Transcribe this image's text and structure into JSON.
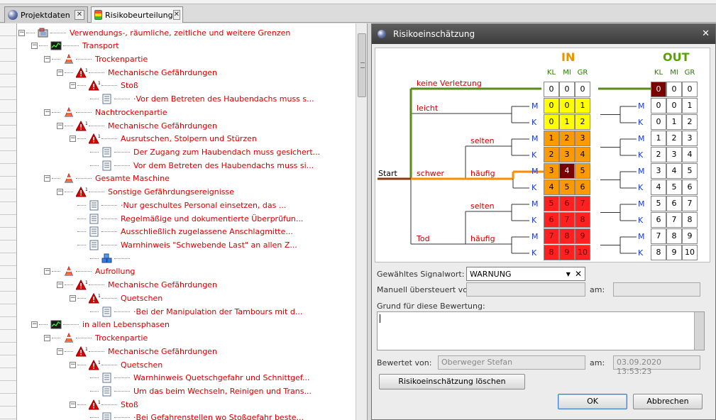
{
  "tabs": [
    {
      "label": "Projektdaten"
    },
    {
      "label": "Risikobeurteilung"
    }
  ],
  "tab_close_glyph": "✕",
  "tree": {
    "rows": [
      {
        "level": 0,
        "icon": "machine-icon",
        "label": "Verwendungs-, räumliche, zeitliche und weitere Grenzen",
        "expand": "−"
      },
      {
        "level": 1,
        "icon": "phase-icon",
        "label": "Transport",
        "expand": "−"
      },
      {
        "level": 2,
        "icon": "cone-icon",
        "label": "Trockenpartie",
        "expand": "−"
      },
      {
        "level": 3,
        "icon": "hazard-icon",
        "label": "Mechanische Gefährdungen",
        "expand": "−"
      },
      {
        "level": 4,
        "icon": "hazard-icon",
        "label": "Stoß",
        "expand": "−"
      },
      {
        "level": 5,
        "icon": "measure-icon",
        "label": "·Vor dem Betreten des Haubendachs muss s...",
        "expand": ""
      },
      {
        "level": 2,
        "icon": "cone-icon",
        "label": "Nachtrockenpartie",
        "expand": "−"
      },
      {
        "level": 3,
        "icon": "hazard-icon",
        "label": "Mechanische Gefährdungen",
        "expand": "−"
      },
      {
        "level": 4,
        "icon": "hazard-icon",
        "label": "Ausrutschen, Stolpern und Stürzen",
        "expand": "−"
      },
      {
        "level": 5,
        "icon": "measure-icon",
        "label": "Der Zugang zum Haubendach muss gesichert...",
        "expand": ""
      },
      {
        "level": 5,
        "icon": "measure-icon",
        "label": "Vor dem Betreten des Haubendachs muss si...",
        "expand": ""
      },
      {
        "level": 2,
        "icon": "cone-icon",
        "label": "Gesamte Maschine",
        "expand": "−"
      },
      {
        "level": 3,
        "icon": "hazard-icon",
        "label": "Sonstige Gefährdungsereignisse",
        "expand": "−"
      },
      {
        "level": 4,
        "icon": "measure-icon",
        "label": "·Nur geschultes Personal einsetzen, das ...",
        "expand": ""
      },
      {
        "level": 4,
        "icon": "measure-icon",
        "label": "Regelmäßige und dokumentierte Überprüfun...",
        "expand": ""
      },
      {
        "level": 4,
        "icon": "measure-icon",
        "label": "Ausschließlich zugelassene Anschlagmitte...",
        "expand": ""
      },
      {
        "level": 4,
        "icon": "measure-icon",
        "label": "Warnhinweis \"Schwebende Last\" an allen Z...",
        "expand": ""
      },
      {
        "level": 5,
        "icon": "blocks-icon",
        "label": "",
        "expand": ""
      },
      {
        "level": 2,
        "icon": "cone-icon",
        "label": "Aufrollung",
        "expand": "−"
      },
      {
        "level": 3,
        "icon": "hazard-icon",
        "label": "Mechanische Gefährdungen",
        "expand": "−"
      },
      {
        "level": 4,
        "icon": "hazard-icon",
        "label": "Quetschen",
        "expand": "−"
      },
      {
        "level": 5,
        "icon": "measure-icon",
        "label": "·Bei der Manipulation der Tambours mit d...",
        "expand": ""
      },
      {
        "level": 1,
        "icon": "phase-icon",
        "label": "in allen Lebensphasen",
        "expand": "−"
      },
      {
        "level": 2,
        "icon": "cone-icon",
        "label": "Trockenpartie",
        "expand": "−"
      },
      {
        "level": 3,
        "icon": "hazard-icon",
        "label": "Mechanische Gefährdungen",
        "expand": "−"
      },
      {
        "level": 4,
        "icon": "hazard-icon",
        "label": "Quetschen",
        "expand": "−"
      },
      {
        "level": 5,
        "icon": "measure-icon",
        "label": "Warnhinweis Quetschgefahr und Schnittgef...",
        "expand": ""
      },
      {
        "level": 5,
        "icon": "measure-icon",
        "label": "Um das beim Wechseln, Reinigen und Trans...",
        "expand": ""
      },
      {
        "level": 4,
        "icon": "hazard-icon",
        "label": "Stoß",
        "expand": "−"
      },
      {
        "level": 5,
        "icon": "measure-icon",
        "label": "·Bei Gefahrenstellen wo Stoßgefahr beste...",
        "expand": ""
      }
    ]
  },
  "dialog": {
    "title": "Risikoeinschätzung",
    "close_glyph": "✕",
    "in_label": "IN",
    "out_label": "OUT",
    "col_headers": [
      "KL",
      "MI",
      "GR"
    ],
    "start_label": "Start",
    "severity": {
      "none": "keine Verletzung",
      "light": "leicht",
      "severe": "schwer",
      "death": "Tod"
    },
    "frequency": {
      "rare": "selten",
      "frequent": "häufig"
    },
    "m_label": "M",
    "k_label": "K",
    "in_matrix": [
      [
        "0",
        "0",
        "0"
      ],
      [
        "0",
        "0",
        "1"
      ],
      [
        "0",
        "1",
        "2"
      ],
      [
        "1",
        "2",
        "3"
      ],
      [
        "2",
        "3",
        "4"
      ],
      [
        "3",
        "4",
        "5"
      ],
      [
        "4",
        "5",
        "6"
      ],
      [
        "5",
        "6",
        "7"
      ],
      [
        "6",
        "7",
        "8"
      ],
      [
        "7",
        "8",
        "9"
      ],
      [
        "8",
        "9",
        "10"
      ]
    ],
    "out_matrix": [
      [
        "0",
        "0",
        "0"
      ],
      [
        "0",
        "0",
        "1"
      ],
      [
        "0",
        "1",
        "2"
      ],
      [
        "1",
        "2",
        "3"
      ],
      [
        "2",
        "3",
        "4"
      ],
      [
        "3",
        "4",
        "5"
      ],
      [
        "4",
        "5",
        "6"
      ],
      [
        "5",
        "6",
        "7"
      ],
      [
        "6",
        "7",
        "8"
      ],
      [
        "7",
        "8",
        "9"
      ],
      [
        "8",
        "9",
        "10"
      ]
    ],
    "selected_in": {
      "row": 5,
      "col": 1
    },
    "selected_out": {
      "row": 0,
      "col": 0
    },
    "colors": {
      "yellow": "#ffff00",
      "orange": "#ff9900",
      "red": "#ff2020",
      "selected": "#7a0000",
      "white": "#ffffff",
      "green_path": "#5a8a18",
      "orange_path": "#ff8c00",
      "brown_path": "#8a3a10"
    },
    "signal_label": "Gewähltes Signalwort:",
    "signal_value": "WARNUNG",
    "override_label": "Manuell übersteuert von:",
    "override_value": "",
    "am_label": "am:",
    "override_date": "",
    "reason_label": "Grund für diese Bewertung:",
    "reason_value": "",
    "rated_label": "Bewertet von:",
    "rated_value": "Oberweger Stefan",
    "rated_date": "03.09.2020 13:53:23",
    "delete_button": "Risikoeinschätzung löschen",
    "ok_button": "OK",
    "cancel_button": "Abbrechen"
  }
}
